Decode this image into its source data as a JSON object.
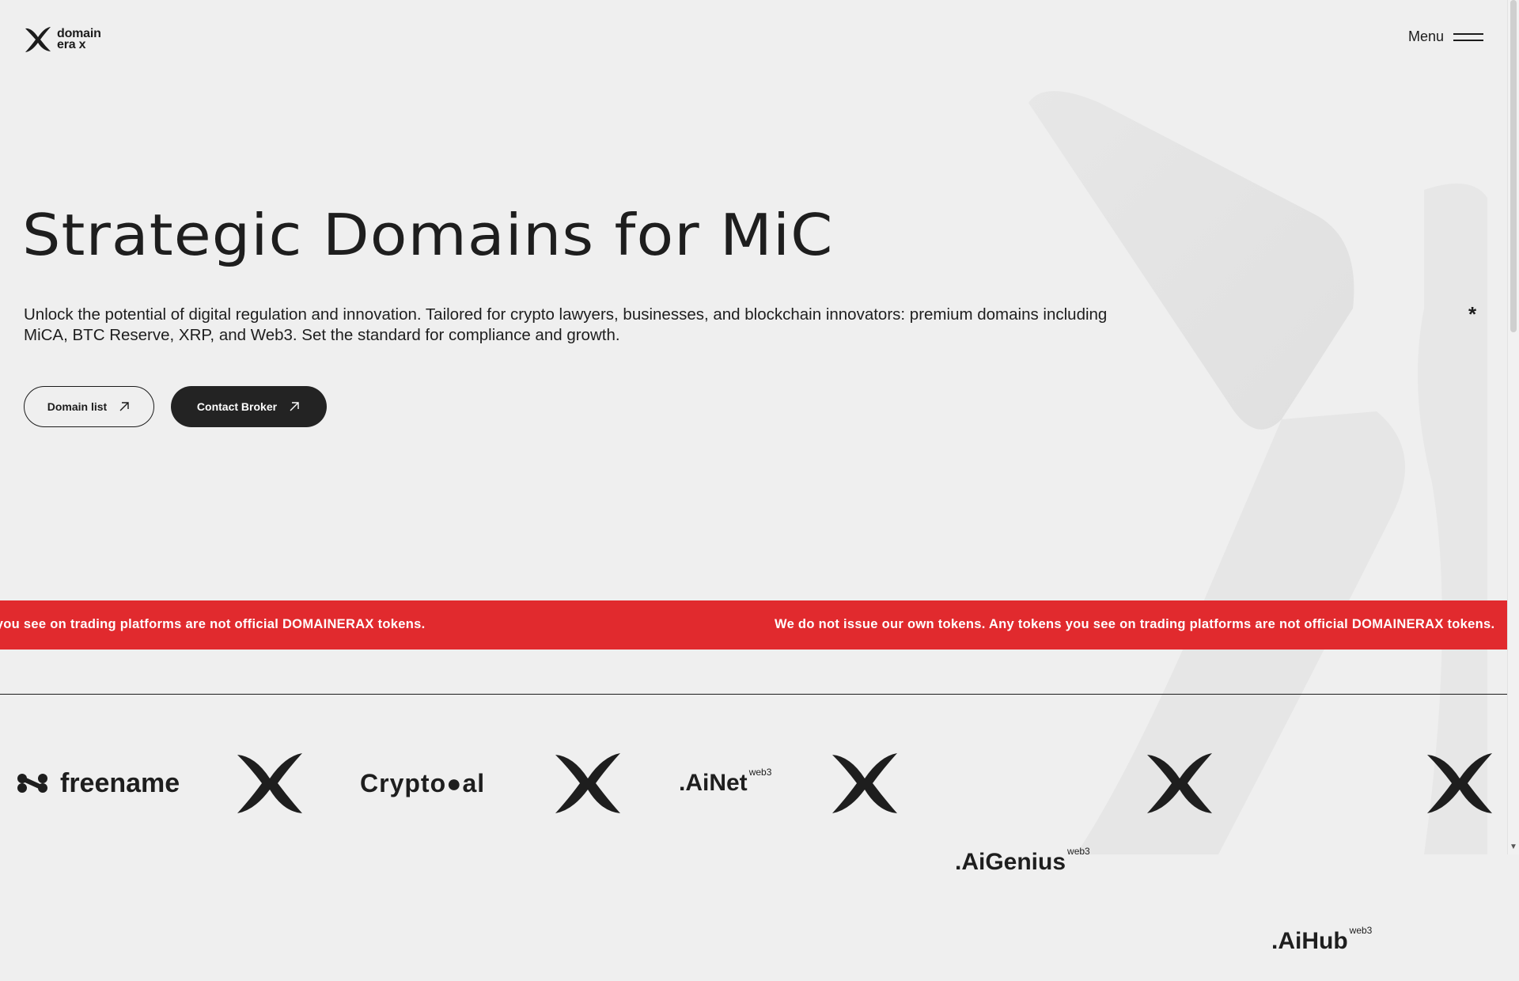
{
  "header": {
    "logo_line1": "domain",
    "logo_line2": "era x",
    "menu_label": "Menu"
  },
  "hero": {
    "title": "Strategic Domains for MiC",
    "description": "Unlock the potential of digital regulation and innovation. Tailored for crypto lawyers, businesses, and blockchain innovators: premium domains including MiCA, BTC Reserve, XRP, and Web3. Set the standard for compliance and growth.",
    "asterisk": "*",
    "buttons": {
      "domain_list": "Domain list",
      "contact_broker": "Contact Broker"
    }
  },
  "ticker": {
    "text_partial": "kens. Any tokens you see on trading platforms are not official DOMAINERAX tokens.",
    "text_full": "We do not issue our own tokens. Any tokens you see on trading platforms are not official DOMAINERAX tokens."
  },
  "partners": {
    "freename": "freename",
    "cryptoal": "Crypto●al",
    "ainet": ".AiNet",
    "aigenius": ".AiGenius",
    "aihub": ".AiHub",
    "web3": "web3"
  },
  "colors": {
    "background": "#efefef",
    "text": "#1c1c1c",
    "ticker_bg": "#e12a2e",
    "button_dark": "#232323"
  }
}
